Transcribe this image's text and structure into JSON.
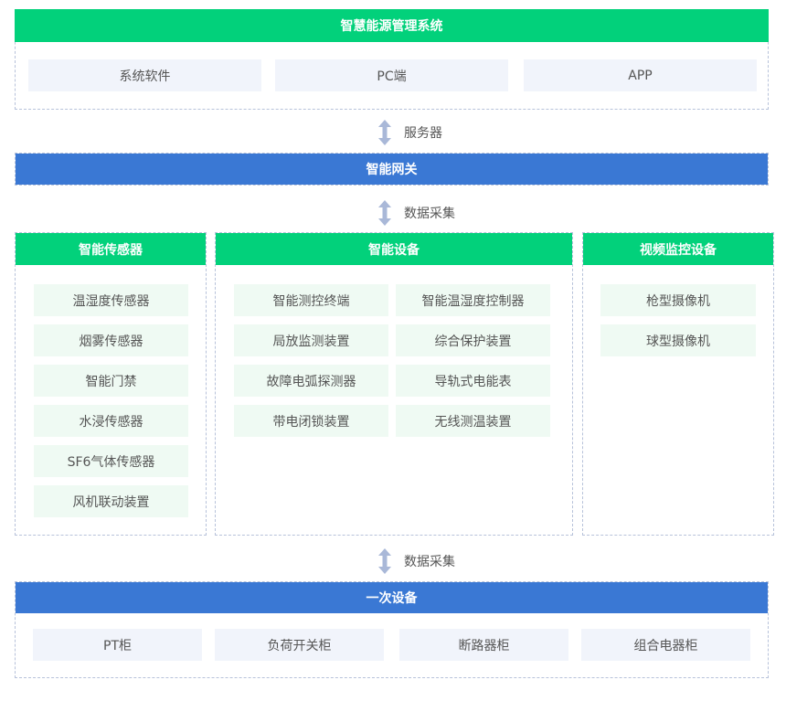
{
  "top": {
    "title": "智慧能源管理系统",
    "items": [
      "系统软件",
      "PC端",
      "APP"
    ]
  },
  "connectors": {
    "server": "服务器",
    "collect1": "数据采集",
    "collect2": "数据采集"
  },
  "gateway": {
    "title": "智能网关"
  },
  "sensors": {
    "title": "智能传感器",
    "items": [
      "温湿度传感器",
      "烟雾传感器",
      "智能门禁",
      "水浸传感器",
      "SF6气体传感器",
      "风机联动装置"
    ]
  },
  "devices": {
    "title": "智能设备",
    "items": [
      "智能测控终端",
      "智能温湿度控制器",
      "局放监测装置",
      "综合保护装置",
      "故障电弧探测器",
      "导轨式电能表",
      "带电闭锁装置",
      "无线测温装置"
    ]
  },
  "video": {
    "title": "视频监控设备",
    "items": [
      "枪型摄像机",
      "球型摄像机"
    ]
  },
  "primary": {
    "title": "一次设备",
    "items": [
      "PT柜",
      "负荷开关柜",
      "断路器柜",
      "组合电器柜"
    ]
  },
  "colors": {
    "green": "#02d17b",
    "blue": "#3a78d4",
    "chip_grey": "#f1f4fb",
    "chip_mint": "#effaf3",
    "border": "#b7c2da"
  }
}
